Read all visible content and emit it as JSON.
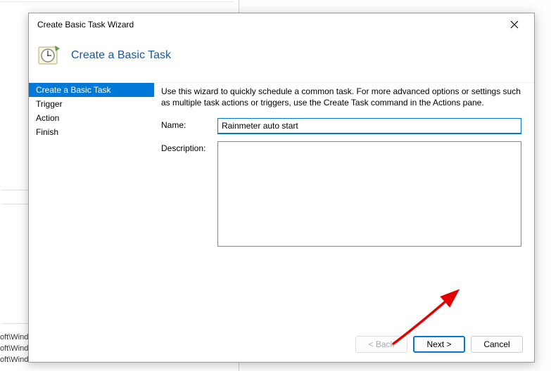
{
  "background": {
    "bottom_lines": [
      "oft\\Windo",
      "oft\\Windows\\U...",
      "oft\\Windows\\Eli"
    ]
  },
  "dialog": {
    "title": "Create Basic Task Wizard",
    "header_title": "Create a Basic Task",
    "sidebar": {
      "items": [
        {
          "label": "Create a Basic Task",
          "active": true
        },
        {
          "label": "Trigger",
          "active": false
        },
        {
          "label": "Action",
          "active": false
        },
        {
          "label": "Finish",
          "active": false
        }
      ]
    },
    "main": {
      "instructions": "Use this wizard to quickly schedule a common task.  For more advanced options or settings such as multiple task actions or triggers, use the Create Task command in the Actions pane.",
      "name_label": "Name:",
      "name_value": "Rainmeter auto start",
      "description_label": "Description:",
      "description_value": ""
    },
    "buttons": {
      "back": "< Back",
      "next": "Next >",
      "cancel": "Cancel"
    }
  }
}
